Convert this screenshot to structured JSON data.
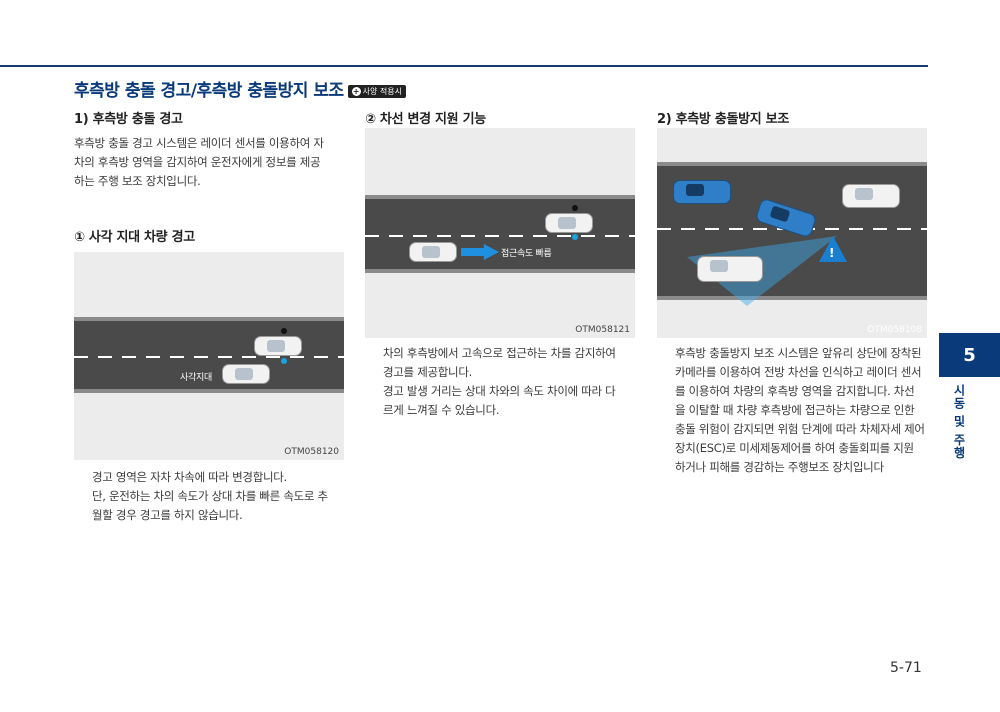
{
  "title": "후측방 충돌 경고/후측방 충돌방지 보조",
  "option_badge": "사양 적용시",
  "section1": {
    "heading": "1) 후측방 충돌 경고",
    "body": [
      "후측방 충돌 경고 시스템은 레이더 센서를 이용하여 자",
      "차의 후측방 영역을 감지하여 운전자에게 정보를 제공",
      "하는 주행 보조 장치입니다."
    ]
  },
  "sub1": {
    "heading": "① 사각 지대 차량 경고",
    "figure_code": "OTM058120",
    "figure_label": "사각지대",
    "body": [
      "경고 영역은 자차 차속에 따라 변경합니다.",
      "단, 운전하는 차의 속도가 상대 차를 빠른 속도로 추",
      "월할 경우 경고를 하지 않습니다."
    ]
  },
  "sub2": {
    "heading": "② 차선 변경 지원 기능",
    "figure_code": "OTM058121",
    "figure_label": "접근속도 빠름",
    "body": [
      "차의 후측방에서 고속으로 접근하는 차를 감지하여",
      "경고를 제공합니다.",
      "경고 발생 거리는 상대 차와의 속도 차이에 따라 다",
      "르게 느껴질 수 있습니다."
    ]
  },
  "section2": {
    "heading": "2) 후측방 충돌방지 보조",
    "figure_code": "OTM058108",
    "body": [
      "후측방 충돌방지 보조 시스템은 앞유리 상단에 장착된",
      "카메라를 이용하여 전방 차선을 인식하고 레이더 센서",
      "를 이용하여 차량의 후측방 영역을 감지합니다. 차선",
      "을 이탈할 때 차량 후측방에 접근하는 차량으로 인한",
      "충돌 위험이 감지되면 위험 단계에 따라 차체자세 제어",
      "장치(ESC)로 미세제동제어를 하여 충돌회피를 지원",
      "하거나 피해를 경감하는 주행보조 장치입니다"
    ]
  },
  "side_tab": {
    "number": "5",
    "label": "시동 및 주행"
  },
  "page_number": "5-71"
}
